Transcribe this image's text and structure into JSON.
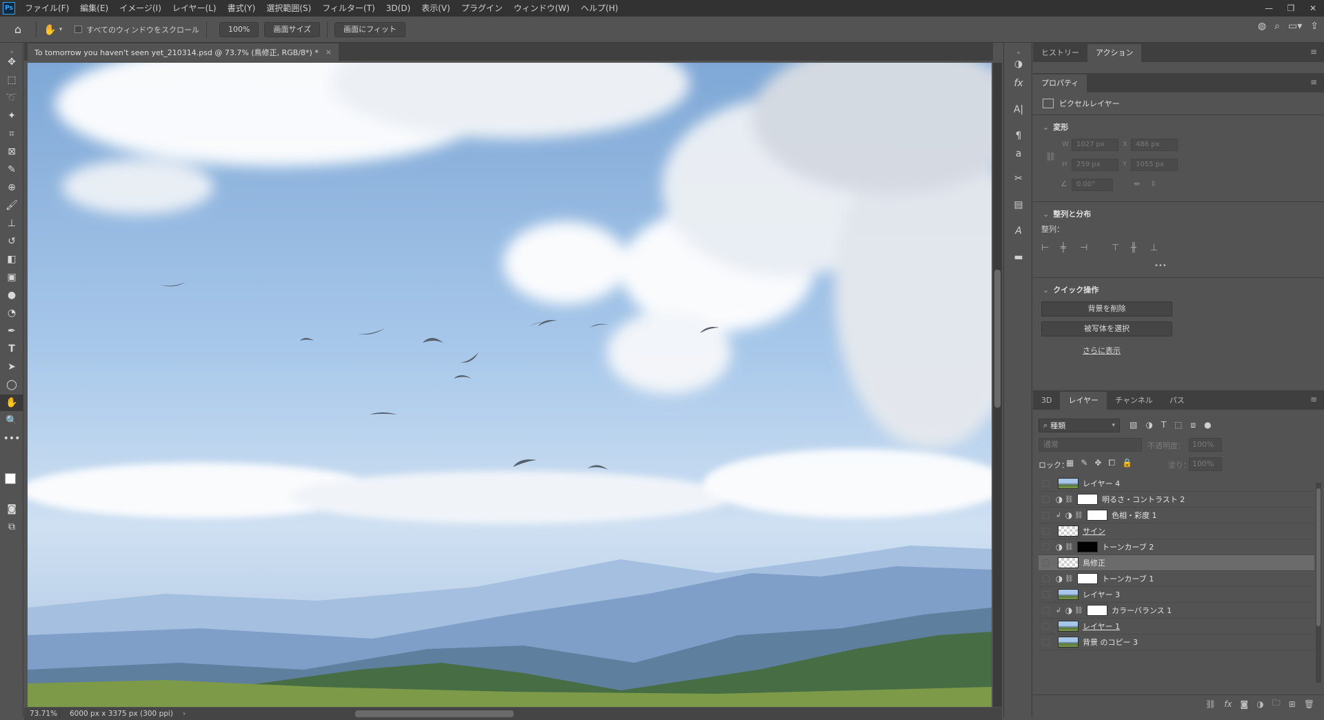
{
  "menubar": {
    "logo": "Ps",
    "items": [
      "ファイル(F)",
      "編集(E)",
      "イメージ(I)",
      "レイヤー(L)",
      "書式(Y)",
      "選択範囲(S)",
      "フィルター(T)",
      "3D(D)",
      "表示(V)",
      "プラグイン",
      "ウィンドウ(W)",
      "ヘルプ(H)"
    ],
    "window_controls": [
      "—",
      "❐",
      "✕"
    ]
  },
  "options": {
    "scroll_all_label": "すべてのウィンドウをスクロール",
    "zoom_value": "100%",
    "fit_screen_label": "画面サイズ",
    "fill_screen_label": "画面にフィット"
  },
  "document": {
    "tab_title": "To tomorrow you haven't seen yet_210314.psd @ 73.7% (鳥修正, RGB/8*) *",
    "tab_close": "×"
  },
  "status": {
    "zoom": "73.71%",
    "doc_info": "6000 px x 3375 px (300 ppi)",
    "arrow": "›"
  },
  "top_panel": {
    "tabs": [
      "ヒストリー",
      "アクション"
    ],
    "active_tab": "アクション"
  },
  "properties": {
    "tab": "プロパティ",
    "layer_type": "ピクセルレイヤー",
    "transform": {
      "title": "変形",
      "w_label": "W",
      "w_value": "1027 px",
      "x_label": "X",
      "x_value": "486 px",
      "h_label": "H",
      "h_value": "259 px",
      "y_label": "Y",
      "y_value": "1055 px",
      "angle_value": "0.00°"
    },
    "align": {
      "title": "整列と分布",
      "label": "整列：",
      "more": "•••"
    },
    "quick_actions": {
      "title": "クイック操作",
      "remove_bg": "背景を削除",
      "select_subject": "被写体を選択",
      "show_more": "さらに表示"
    }
  },
  "layers_panel": {
    "tabs": [
      "3D",
      "レイヤー",
      "チャンネル",
      "パス"
    ],
    "active_tab": "レイヤー",
    "filter_kind": "種類",
    "blend_mode": "通常",
    "opacity_label": "不透明度：",
    "opacity_value": "100%",
    "lock_label": "ロック：",
    "fill_label": "塗り：",
    "fill_value": "100%",
    "layers": [
      {
        "name": "レイヤー 4",
        "thumb": "landscape",
        "adj": false,
        "clip": false,
        "selected": false,
        "underline": false
      },
      {
        "name": "明るさ・コントラスト 2",
        "thumb": "white",
        "adj": true,
        "clip": false,
        "selected": false,
        "underline": false
      },
      {
        "name": "色相・彩度 1",
        "thumb": "white",
        "adj": true,
        "clip": true,
        "selected": false,
        "underline": false
      },
      {
        "name": "サイン",
        "thumb": "checker",
        "adj": false,
        "clip": false,
        "selected": false,
        "underline": true
      },
      {
        "name": "トーンカーブ 2",
        "thumb": "black",
        "adj": true,
        "clip": false,
        "selected": false,
        "underline": false
      },
      {
        "name": "鳥修正",
        "thumb": "checker",
        "adj": false,
        "clip": false,
        "selected": true,
        "underline": false
      },
      {
        "name": "トーンカーブ 1",
        "thumb": "white",
        "adj": true,
        "clip": false,
        "selected": false,
        "underline": false
      },
      {
        "name": "レイヤー 3",
        "thumb": "landscape",
        "adj": false,
        "clip": false,
        "selected": false,
        "underline": false
      },
      {
        "name": "カラーバランス 1",
        "thumb": "white",
        "adj": true,
        "clip": true,
        "selected": false,
        "underline": false
      },
      {
        "name": "レイヤー 1",
        "thumb": "landscape",
        "adj": false,
        "clip": false,
        "selected": false,
        "underline": true
      },
      {
        "name": "背景 のコピー 3",
        "thumb": "landscape",
        "adj": false,
        "clip": false,
        "selected": false,
        "underline": false
      }
    ]
  },
  "colors": {
    "accent": "#31a8ff",
    "panel_bg": "#535353",
    "menubar_bg": "#323232",
    "selected_layer": "#6b6b6b"
  }
}
